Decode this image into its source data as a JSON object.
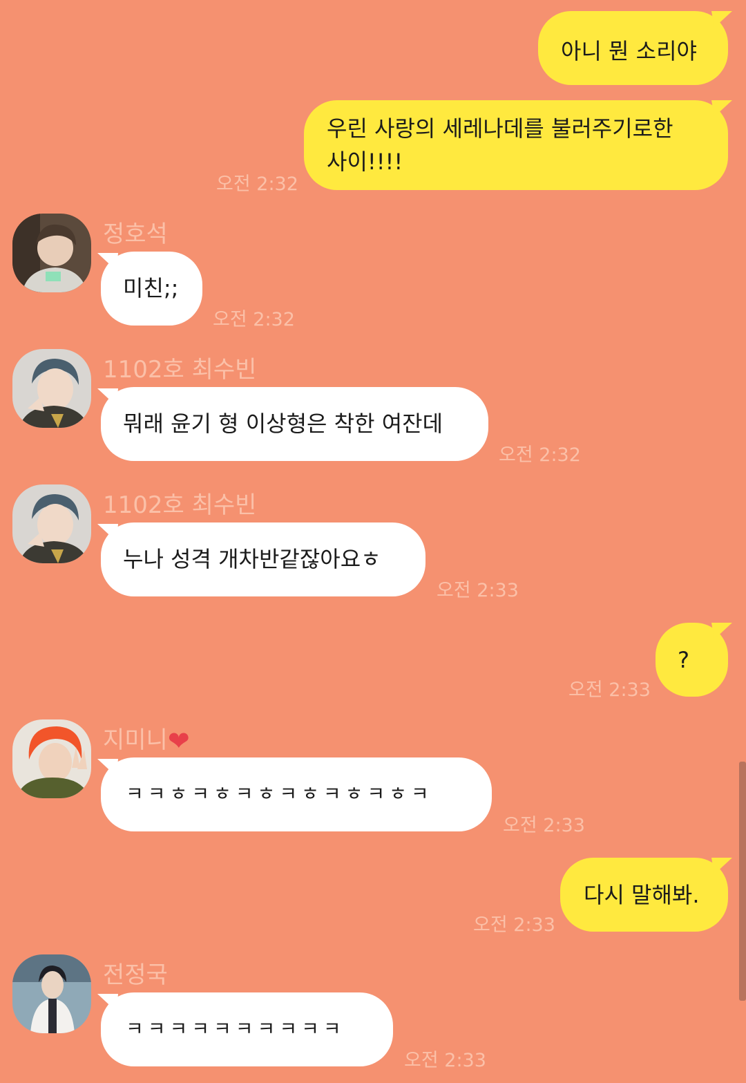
{
  "colors": {
    "background": "#F59170",
    "my_bubble": "#FFE93F",
    "other_bubble": "#FFFFFF",
    "meta_text": "#FBC0A8"
  },
  "messages": [
    {
      "from": "me",
      "text": "아니 뭔 소리야"
    },
    {
      "from": "me",
      "line1": "우린 사랑의 세레나데를 불러주기로한",
      "line2": "사이!!!!",
      "time": "오전 2:32"
    },
    {
      "from": "정호석",
      "sender": "정호석",
      "text": "미친;;",
      "time": "오전 2:32"
    },
    {
      "from": "1102호 최수빈",
      "sender": "1102호 최수빈",
      "text": "뭐래 윤기 형 이상형은 착한 여잔데",
      "time": "오전 2:32"
    },
    {
      "from": "1102호 최수빈",
      "sender": "1102호 최수빈",
      "text": "누나 성격 개차반같잖아요ㅎ",
      "time": "오전 2:33"
    },
    {
      "from": "me",
      "text": "?",
      "time": "오전 2:33"
    },
    {
      "from": "지미니",
      "sender": "지미니",
      "sender_icon": "heart-icon",
      "text": "ㅋㅋㅎㅋㅎㅋㅎㅋㅎㅋㅎㅋㅎㅋ",
      "time": "오전 2:33"
    },
    {
      "from": "me",
      "text": "다시 말해봐.",
      "time": "오전 2:33"
    },
    {
      "from": "전정국",
      "sender": "전정국",
      "text": "ㅋㅋㅋㅋㅋㅋㅋㅋㅋㅋ",
      "time": "오전 2:33"
    }
  ],
  "heart_glyph": "❤"
}
